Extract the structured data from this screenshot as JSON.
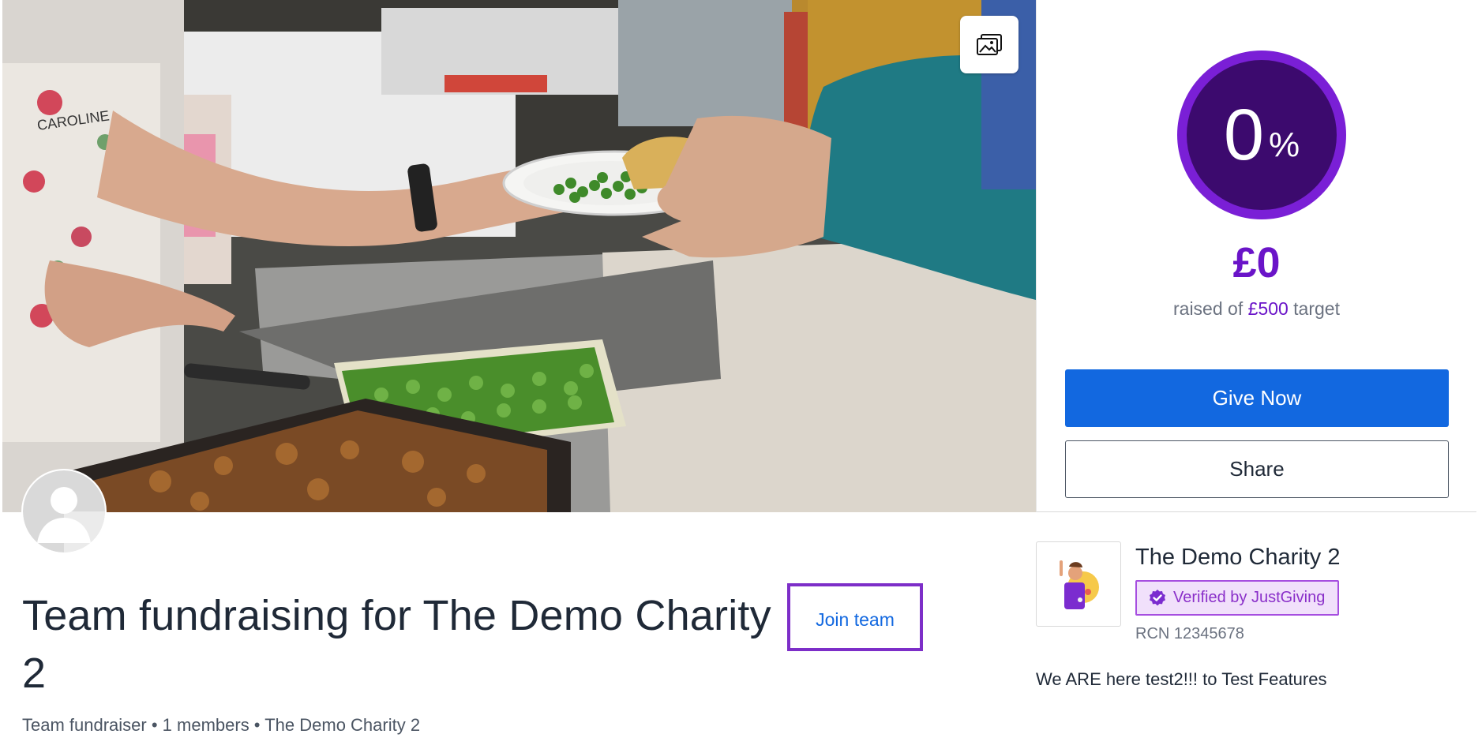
{
  "hero": {
    "gallery_icon": "image-gallery-icon",
    "apron_text": "CAROLINE"
  },
  "donation": {
    "progress_value": "0",
    "progress_unit": "%",
    "progress_fraction": 0,
    "amount_raised": "£0",
    "raised_prefix": "raised of",
    "target_amount": "£500",
    "raised_suffix": "target",
    "give_label": "Give Now",
    "share_label": "Share"
  },
  "page": {
    "avatar_icon": "default-user-avatar-icon",
    "title": "Team fundraising for The Demo Charity 2",
    "join_label": "Join team",
    "meta": "Team fundraiser • 1 members • The Demo Charity 2"
  },
  "charity": {
    "logo_icon": "charity-logo-icon",
    "name": "The Demo Charity 2",
    "verified_icon": "verified-check-icon",
    "verified_label": "Verified by JustGiving",
    "rcn": "RCN 12345678",
    "description": "We ARE here test2!!! to Test Features"
  },
  "colors": {
    "brand_purple": "#6a14c8",
    "ring_purple": "#7a1fd6",
    "ring_fill": "#3c0a6e",
    "give_blue": "#1268e0",
    "join_border": "#7d2ec8"
  }
}
